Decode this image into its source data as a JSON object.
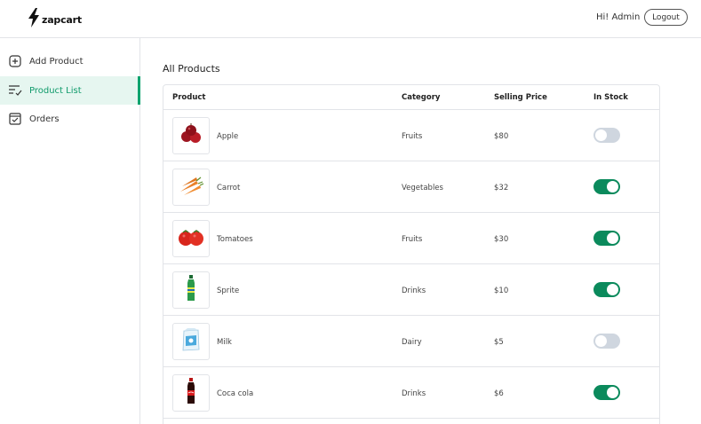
{
  "header": {
    "brand": "zapcart",
    "greeting": "Hi! Admin",
    "logout_label": "Logout"
  },
  "sidebar": {
    "items": [
      {
        "label": "Add Product",
        "icon": "plus-square-icon",
        "active": false
      },
      {
        "label": "Product List",
        "icon": "list-check-icon",
        "active": true
      },
      {
        "label": "Orders",
        "icon": "check-square-icon",
        "active": false
      }
    ]
  },
  "main": {
    "title": "All Products",
    "columns": [
      "Product",
      "Category",
      "Selling Price",
      "In Stock"
    ],
    "rows": [
      {
        "name": "Apple",
        "category": "Fruits",
        "price": "$80",
        "in_stock": false,
        "image": "apple-image"
      },
      {
        "name": "Carrot",
        "category": "Vegetables",
        "price": "$32",
        "in_stock": true,
        "image": "carrot-image"
      },
      {
        "name": "Tomatoes",
        "category": "Fruits",
        "price": "$30",
        "in_stock": true,
        "image": "tomato-image"
      },
      {
        "name": "Sprite",
        "category": "Drinks",
        "price": "$10",
        "in_stock": true,
        "image": "sprite-bottle-image"
      },
      {
        "name": "Milk",
        "category": "Dairy",
        "price": "$5",
        "in_stock": false,
        "image": "milk-pack-image"
      },
      {
        "name": "Coca cola",
        "category": "Drinks",
        "price": "$6",
        "in_stock": true,
        "image": "coca-cola-bottle-image"
      }
    ]
  },
  "colors": {
    "accent": "#0aa36e",
    "toggle_on": "#0b8a5c",
    "toggle_off": "#cfd6df",
    "active_nav_bg": "#e6f6f0"
  }
}
